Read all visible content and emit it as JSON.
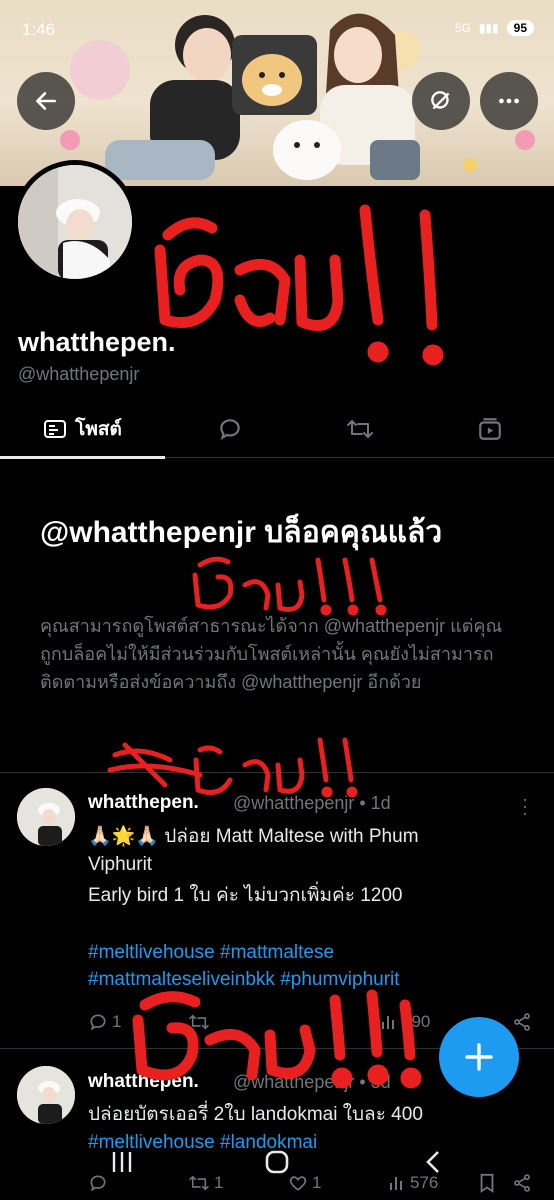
{
  "status_bar": {
    "time": "1:46",
    "network": "5G",
    "battery": "95"
  },
  "profile": {
    "display_name": "whatthepen.",
    "handle": "@whatthepenjr"
  },
  "tabs": [
    {
      "label": "โพสต์",
      "icon": "posts-icon",
      "active": true
    },
    {
      "label": "",
      "icon": "reply-bubble-icon"
    },
    {
      "label": "",
      "icon": "retweet-icon"
    },
    {
      "label": "",
      "icon": "media-icon"
    }
  ],
  "blocked_notice": {
    "title": "@whatthepenjr บล็อคคุณแล้ว",
    "description": "คุณสามารถดูโพสต์สาธารณะได้จาก @whatthepenjr แต่คุณถูกบล็อคไม่ให้มีส่วนร่วมกับโพสต์เหล่านั้น คุณยังไม่สามารถติดตามหรือส่งข้อความถึง @whatthepenjr อีกด้วย"
  },
  "tweets": [
    {
      "name": "whatthepen.",
      "meta": "@whatthepenjr • 1d",
      "line1": "🙏🏻🌟🙏🏻 ปล่อย Matt Maltese with Phum",
      "line2": "Viphurit",
      "line3": "Early bird 1 ใบ ค่ะ ไม่บวกเพิ่มค่ะ 1200",
      "hashtags_line1": "#meltlivehouse #mattmaltese",
      "hashtags_line2": "#mattmalteseliveinbkk #phumviphurit",
      "reply_count": "1",
      "views": "290"
    },
    {
      "name": "whatthepen.",
      "meta": "@whatthepenjr • 3d",
      "line1": "ปล่อยบัตรเออรี่ 2ใบ landokmai ใบละ 400",
      "hashtags_line1": "#meltlivehouse #landokmai",
      "retweet_count": "1",
      "like_count": "1",
      "views": "576"
    }
  ],
  "handwritten_annotations": [
    "โกง!!",
    "โกง!!!",
    "ฆ่าโกง!!!",
    "โกง!!!"
  ],
  "colors": {
    "background": "#000000",
    "accent": "#1d9bf0",
    "muted": "#71767b",
    "annotation": "#e8201f"
  }
}
